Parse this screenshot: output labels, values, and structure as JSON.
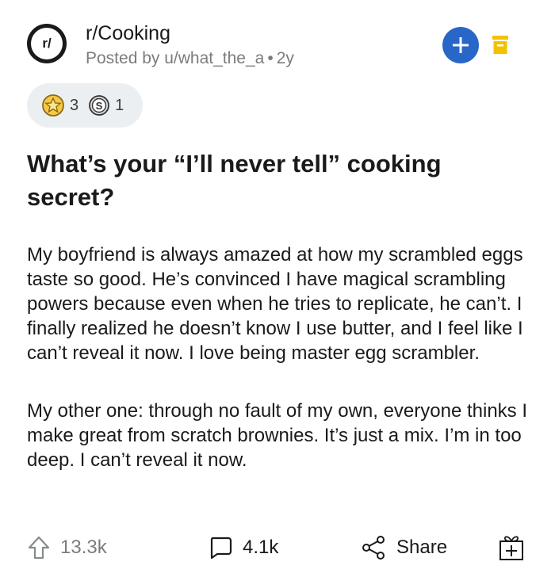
{
  "header": {
    "subreddit_icon_text": "r/",
    "subreddit": "r/Cooking",
    "posted_by": "Posted by u/what_the_a",
    "separator": "•",
    "age": "2y",
    "join_icon": "plus-icon",
    "archive_icon": "archive-icon",
    "accent_color": "#2866c7",
    "archive_color": "#f2c200"
  },
  "awards": [
    {
      "icon": "helpful-award-icon",
      "count": "3"
    },
    {
      "icon": "silver-award-icon",
      "count": "1"
    }
  ],
  "post": {
    "title": "What’s your “I’ll never tell” cooking secret?",
    "paragraphs": [
      "My boyfriend is always amazed at how my scrambled eggs taste so good. He’s convinced I have magical scrambling powers because even when he tries to replicate, he can’t. I finally realized he doesn’t know I use butter, and I feel like I can’t reveal it now. I love being master egg scrambler.",
      "My other one: through no fault of my own, everyone thinks I make great from scratch brownies. It’s just a mix. I’m in too deep. I can’t reveal it now."
    ]
  },
  "footer": {
    "upvotes": "13.3k",
    "comments": "4.1k",
    "share_label": "Share",
    "upvote_icon": "upvote-arrow-icon",
    "comment_icon": "comment-bubble-icon",
    "share_icon": "share-icon",
    "award_icon": "give-award-icon"
  }
}
